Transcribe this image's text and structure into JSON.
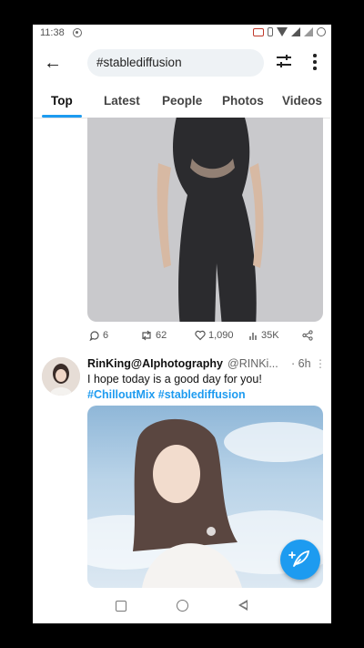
{
  "status_bar": {
    "time": "11:38"
  },
  "search": {
    "query": "#stablediffusion"
  },
  "tabs": [
    {
      "label": "Top",
      "active": true
    },
    {
      "label": "Latest"
    },
    {
      "label": "People"
    },
    {
      "label": "Photos"
    },
    {
      "label": "Videos"
    }
  ],
  "tweet1": {
    "actions": {
      "replies": "6",
      "retweets": "62",
      "likes": "1,090",
      "views": "35K"
    }
  },
  "tweet2": {
    "name": "RinKing@AIphotography",
    "handle": "@RINKi...",
    "time": "· 6h",
    "text": "I hope today is a good day for you!",
    "hashtags": "#ChilloutMix #stablediffusion"
  },
  "colors": {
    "accent": "#1d9bf0",
    "search_bg": "#eef2f5"
  },
  "icons": [
    "back-arrow-icon",
    "filter-icon",
    "more-icon",
    "reply-icon",
    "retweet-icon",
    "like-icon",
    "views-icon",
    "share-icon",
    "compose-icon"
  ]
}
